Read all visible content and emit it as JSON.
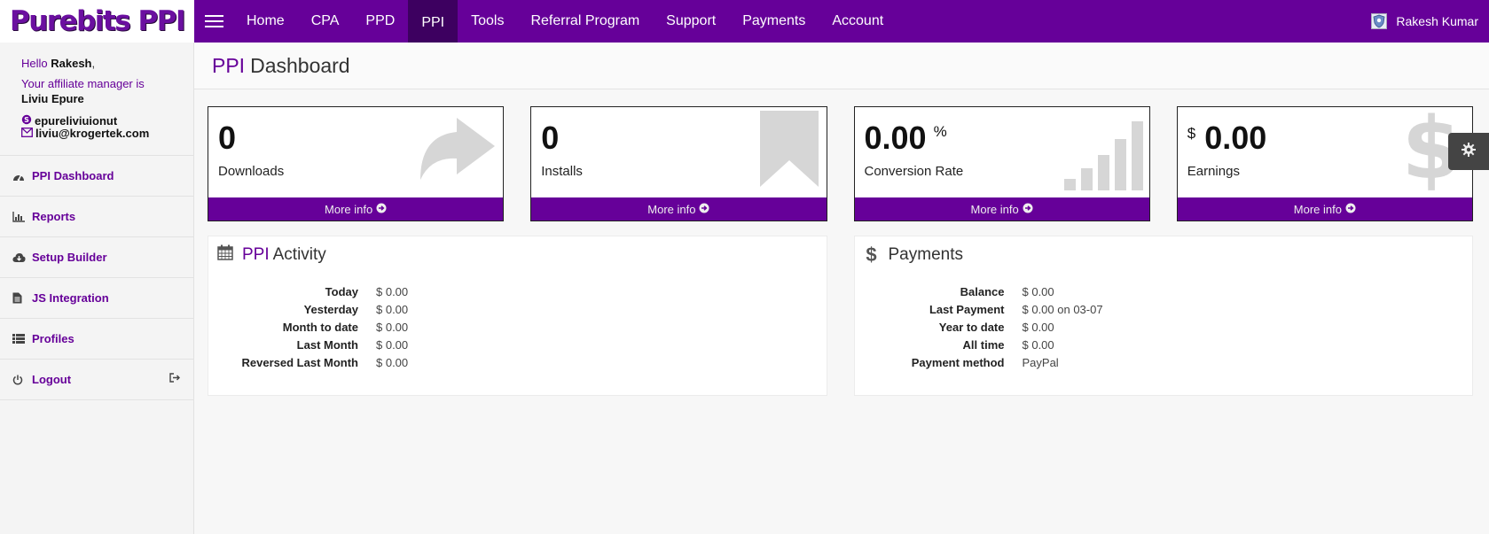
{
  "logo": {
    "text": "Purebits PPI"
  },
  "nav": {
    "items": [
      {
        "label": "Home"
      },
      {
        "label": "CPA"
      },
      {
        "label": "PPD"
      },
      {
        "label": "PPI"
      },
      {
        "label": "Tools"
      },
      {
        "label": "Referral Program"
      },
      {
        "label": "Support"
      },
      {
        "label": "Payments"
      },
      {
        "label": "Account"
      }
    ],
    "active": "PPI",
    "user_name": "Rakesh Kumar"
  },
  "sidebar": {
    "hello": "Hello",
    "user_first": "Rakesh",
    "comma": ",",
    "manager_text": "Your affiliate manager is",
    "manager_name": "Liviu Epure",
    "skype": "epureliviuionut",
    "email": "liviu@krogertek.com",
    "menu": [
      {
        "label": "PPI Dashboard",
        "icon": "dashboard-icon"
      },
      {
        "label": "Reports",
        "icon": "bar-chart-icon"
      },
      {
        "label": "Setup Builder",
        "icon": "cloud-download-icon"
      },
      {
        "label": "JS Integration",
        "icon": "file-text-icon"
      },
      {
        "label": "Profiles",
        "icon": "list-icon"
      },
      {
        "label": "Logout",
        "icon": "power-icon"
      }
    ]
  },
  "header": {
    "accent": "PPI",
    "title": "Dashboard"
  },
  "cards": [
    {
      "value": "0",
      "label": "Downloads",
      "footer": "More info",
      "icon": "share-arrow-icon"
    },
    {
      "value": "0",
      "label": "Installs",
      "footer": "More info",
      "icon": "bookmark-icon"
    },
    {
      "value": "0.00",
      "suffix": "%",
      "label": "Conversion Rate",
      "footer": "More info",
      "icon": "signal-bars-icon"
    },
    {
      "prefix": "$",
      "value": "0.00",
      "label": "Earnings",
      "footer": "More info",
      "icon": "dollar-icon"
    }
  ],
  "activity": {
    "accent": "PPI",
    "title": "Activity",
    "rows": [
      {
        "k": "Today",
        "v": "$ 0.00"
      },
      {
        "k": "Yesterday",
        "v": "$ 0.00"
      },
      {
        "k": "Month to date",
        "v": "$ 0.00"
      },
      {
        "k": "Last Month",
        "v": "$ 0.00"
      },
      {
        "k": "Reversed Last Month",
        "v": "$ 0.00"
      }
    ]
  },
  "payments": {
    "symbol": "$",
    "title": "Payments",
    "rows": [
      {
        "k": "Balance",
        "v": "$ 0.00"
      },
      {
        "k": "Last Payment",
        "v": "$ 0.00 on 03-07"
      },
      {
        "k": "Year to date",
        "v": "$ 0.00"
      },
      {
        "k": "All time",
        "v": "$ 0.00"
      },
      {
        "k": "Payment method",
        "v": "PayPal"
      }
    ]
  },
  "colors": {
    "brand": "#660099",
    "active_nav": "#3d0060"
  }
}
